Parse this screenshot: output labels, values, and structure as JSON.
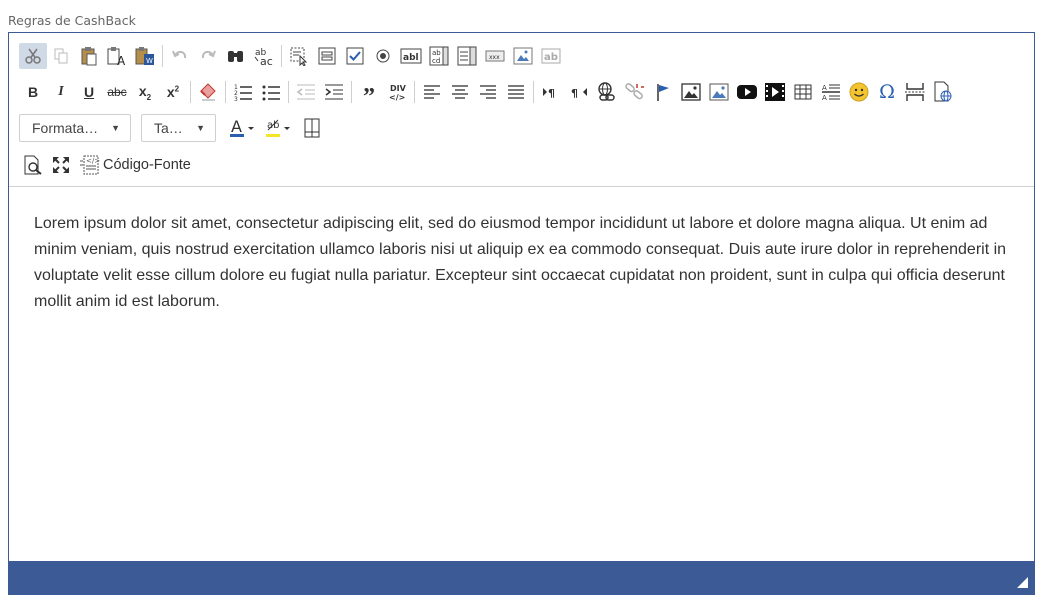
{
  "field": {
    "label": "Regras de CashBack"
  },
  "toolbar": {
    "format_combo": "Formata…",
    "size_combo": "Ta…",
    "source_label": "Código-Fonte"
  },
  "editor": {
    "content": "Lorem ipsum dolor sit amet, consectetur adipiscing elit, sed do eiusmod tempor incididunt ut labore et dolore magna aliqua. Ut enim ad minim veniam, quis nostrud exercitation ullamco laboris nisi ut aliquip ex ea commodo consequat. Duis aute irure dolor in reprehenderit in voluptate velit esse cillum dolore eu fugiat nulla pariatur. Excepteur sint occaecat cupidatat non proident, sunt in culpa qui officia deserunt mollit anim id est laborum."
  },
  "colors": {
    "accent": "#3c5a96",
    "active_button": "#d0d9e6",
    "highlight": "#f5e52a",
    "text_color_bar": "#2a5fb0"
  }
}
